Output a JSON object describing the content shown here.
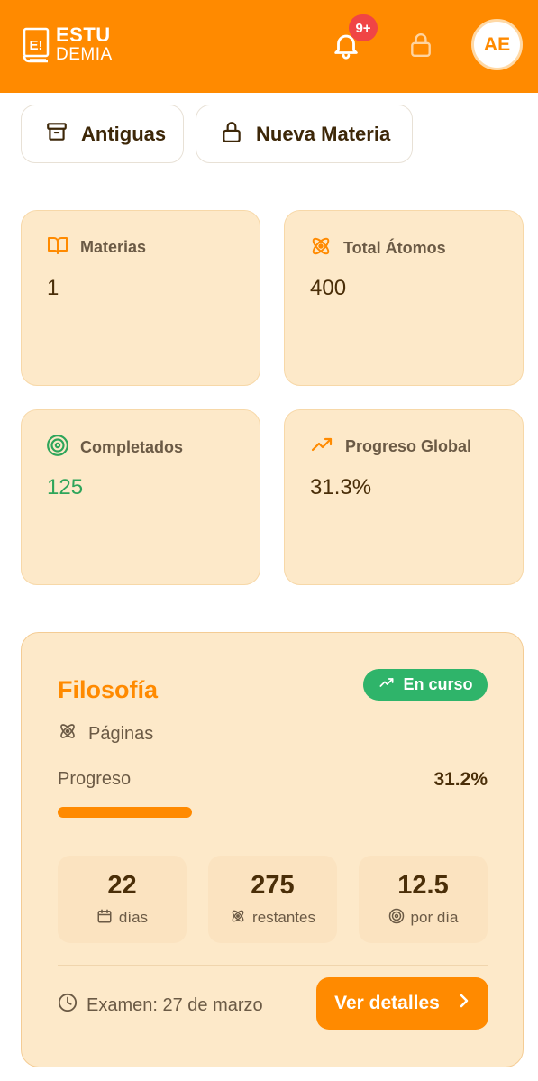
{
  "header": {
    "logo_line1": "ESTU",
    "logo_line2": "DEMIA",
    "logo_mark_text": "E!",
    "notification_badge": "9+",
    "avatar_initials": "AE",
    "brand_color": "#ff8a00",
    "icons": [
      "book-logo-icon",
      "bell-icon",
      "lock-icon"
    ]
  },
  "actions": {
    "antiguas_label": "Antiguas",
    "nueva_label": "Nueva Materia"
  },
  "stats": [
    {
      "label": "Materias",
      "value": "1",
      "icon": "book-open-icon"
    },
    {
      "label": "Total Átomos",
      "value": "400",
      "icon": "atom-icon"
    },
    {
      "label": "Completados",
      "value": "125",
      "icon": "target-icon",
      "value_color": "#2ea55a"
    },
    {
      "label": "Progreso Global",
      "value": "31.3%",
      "icon": "trending-up-icon"
    }
  ],
  "subject": {
    "title": "Filosofía",
    "status": "En curso",
    "status_color": "#2fb46a",
    "type_label": "Páginas",
    "progress_label": "Progreso",
    "progress_text": "31.2%",
    "progress_fraction": 0.312,
    "metrics": [
      {
        "value": "22",
        "caption": "días",
        "icon": "calendar-icon"
      },
      {
        "value": "275",
        "caption": "restantes",
        "icon": "atom-icon"
      },
      {
        "value": "12.5",
        "caption": "por día",
        "icon": "target-icon"
      }
    ],
    "exam_text": "Examen: 27 de marzo",
    "details_label": "Ver detalles"
  }
}
